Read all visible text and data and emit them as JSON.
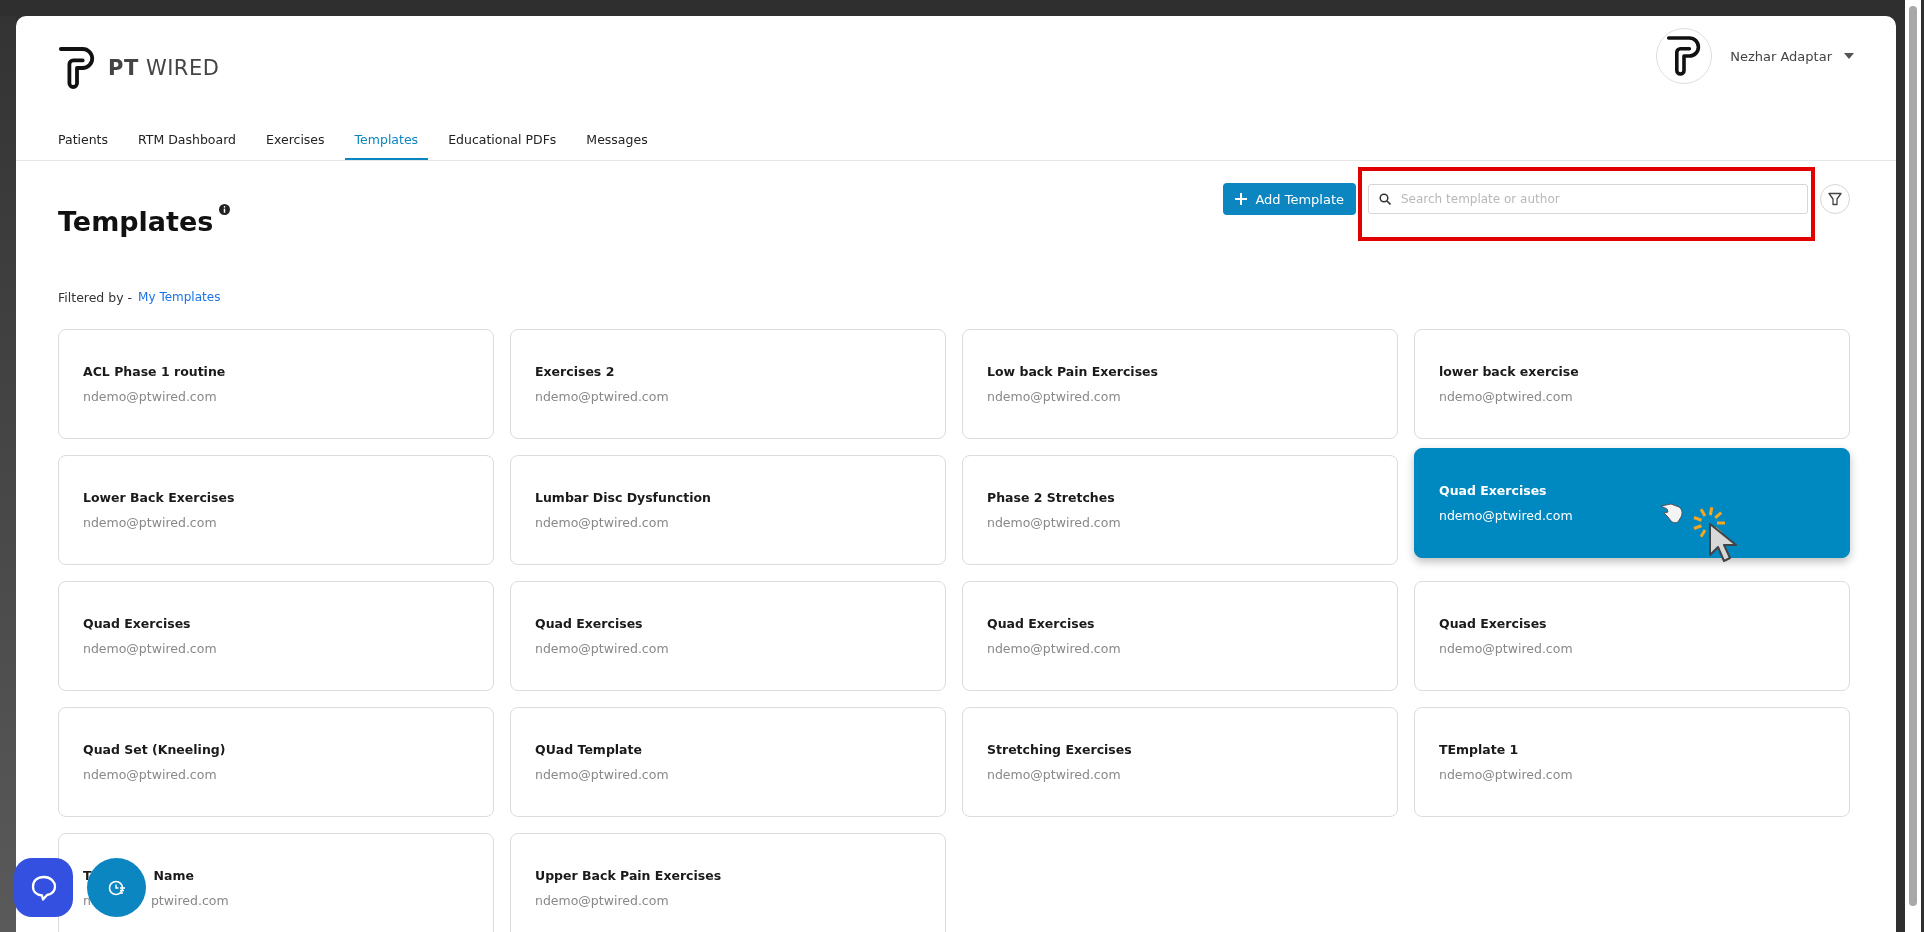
{
  "brand": {
    "bold": "PT",
    "light": "WIRED"
  },
  "user": {
    "name": "Nezhar Adaptar"
  },
  "tabs": [
    {
      "label": "Patients",
      "selected": false
    },
    {
      "label": "RTM Dashboard",
      "selected": false
    },
    {
      "label": "Exercises",
      "selected": false
    },
    {
      "label": "Templates",
      "selected": true
    },
    {
      "label": "Educational PDFs",
      "selected": false
    },
    {
      "label": "Messages",
      "selected": false
    }
  ],
  "page_title": "Templates",
  "add_button": "Add Template",
  "search": {
    "placeholder": "Search template or author"
  },
  "filter": {
    "label": "Filtered by -",
    "value": "My Templates"
  },
  "cards": [
    {
      "title": "ACL Phase 1 routine",
      "email": "ndemo@ptwired.com",
      "selected": false
    },
    {
      "title": "Exercises 2",
      "email": "ndemo@ptwired.com",
      "selected": false
    },
    {
      "title": "Low back Pain Exercises",
      "email": "ndemo@ptwired.com",
      "selected": false
    },
    {
      "title": "lower back exercise",
      "email": "ndemo@ptwired.com",
      "selected": false
    },
    {
      "title": "Lower Back Exercises",
      "email": "ndemo@ptwired.com",
      "selected": false
    },
    {
      "title": "Lumbar Disc Dysfunction",
      "email": "ndemo@ptwired.com",
      "selected": false
    },
    {
      "title": "Phase 2 Stretches",
      "email": "ndemo@ptwired.com",
      "selected": false
    },
    {
      "title": "Quad Exercises",
      "email": "ndemo@ptwired.com",
      "selected": true
    },
    {
      "title": "Quad Exercises",
      "email": "ndemo@ptwired.com",
      "selected": false
    },
    {
      "title": "Quad Exercises",
      "email": "ndemo@ptwired.com",
      "selected": false
    },
    {
      "title": "Quad Exercises",
      "email": "ndemo@ptwired.com",
      "selected": false
    },
    {
      "title": "Quad Exercises",
      "email": "ndemo@ptwired.com",
      "selected": false
    },
    {
      "title": "Quad Set (Kneeling)",
      "email": "ndemo@ptwired.com",
      "selected": false
    },
    {
      "title": "QUad Template",
      "email": "ndemo@ptwired.com",
      "selected": false
    },
    {
      "title": "Stretching Exercises",
      "email": "ndemo@ptwired.com",
      "selected": false
    },
    {
      "title": "TEmplate 1",
      "email": "ndemo@ptwired.com",
      "selected": false
    },
    {
      "title_parts": [
        "T",
        "Name"
      ],
      "email_parts": [
        "n",
        "ptwired.com"
      ],
      "selected": false
    },
    {
      "title": "Upper Back Pain Exercises",
      "email": "ndemo@ptwired.com",
      "selected": false
    }
  ]
}
